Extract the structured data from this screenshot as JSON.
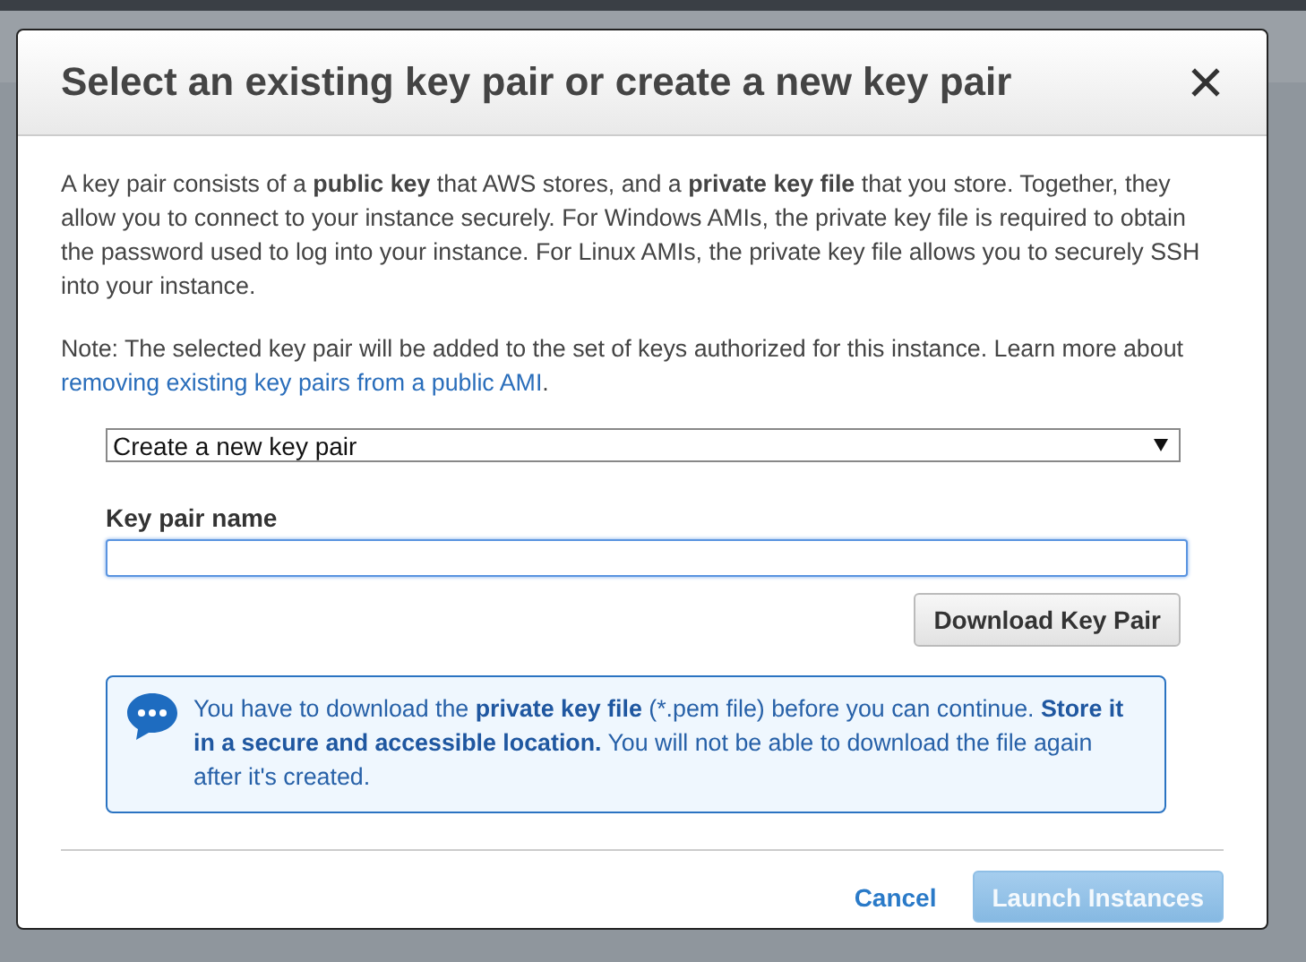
{
  "dialog": {
    "title": "Select an existing key pair or create a new key pair",
    "intro": "A key pair consists of a **public key** that AWS stores, and a **private key file** that you store. Together, they allow you to connect to your instance securely. For Windows AMIs, the private key file is required to obtain the password used to log into your instance. For Linux AMIs, the private key file allows you to securely SSH into your instance.",
    "note": {
      "text": "Note: The selected key pair will be added to the set of keys authorized for this instance. Learn more about",
      "link": "removing existing key pairs from a public AMI",
      "end": "."
    },
    "key_pair_select": {
      "value": "Create a new key pair"
    },
    "key_pair_name": {
      "label": "Key pair name",
      "focused": true
    },
    "download_button": {
      "label": "Download Key Pair"
    },
    "info": {
      "message": "You have to download the **private key file** (*.pem file) before you can continue. **Store it in a secure and accessible location.** You will not be able to download the file again after it's created."
    },
    "buttons": [
      {
        "kind": "link",
        "label": "Cancel",
        "disabled": false
      },
      {
        "kind": "primary",
        "label": "Launch Instances",
        "disabled": true
      }
    ]
  }
}
